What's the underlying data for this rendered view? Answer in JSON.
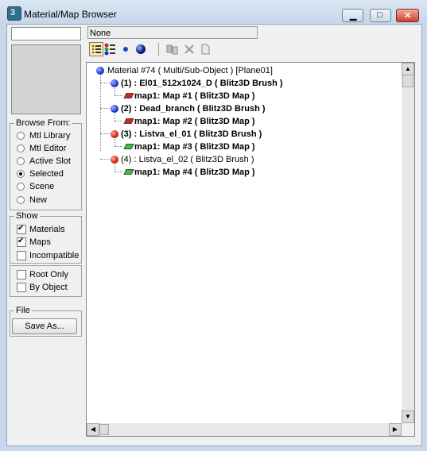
{
  "window": {
    "title": "Material/Map Browser",
    "minimize": "▁",
    "maximize": "□",
    "close": "✕"
  },
  "left": {
    "name_value": "",
    "browse_from": {
      "title": "Browse From:",
      "options": [
        {
          "label": "Mtl Library",
          "selected": false
        },
        {
          "label": "Mtl Editor",
          "selected": false
        },
        {
          "label": "Active Slot",
          "selected": false
        },
        {
          "label": "Selected",
          "selected": true
        },
        {
          "label": "Scene",
          "selected": false
        },
        {
          "label": "New",
          "selected": false
        }
      ]
    },
    "show": {
      "title": "Show",
      "options": [
        {
          "label": "Materials",
          "checked": true
        },
        {
          "label": "Maps",
          "checked": true
        },
        {
          "label": "Incompatible",
          "checked": false
        }
      ]
    },
    "filter": {
      "options": [
        {
          "label": "Root Only",
          "checked": false
        },
        {
          "label": "By Object",
          "checked": false
        }
      ]
    },
    "file": {
      "title": "File",
      "save_as": "Save As..."
    }
  },
  "right": {
    "path_value": "None",
    "toolbar_icons": [
      "list-view-icon",
      "list-icons-view-icon",
      "small-icons-view-icon",
      "large-icons-view-icon",
      "update-scene-materials-icon",
      "delete-icon",
      "clear-library-icon"
    ],
    "tree": [
      {
        "text": "Material #74  ( Multi/Sub-Object ) [Plane01]",
        "icon": "blue",
        "bold": false
      },
      {
        "text": "(1) : El01_512x1024_D  ( Blitz3D Brush )",
        "icon": "blue",
        "bold": true
      },
      {
        "text": "map1: Map #1  ( Blitz3D Map )",
        "icon": "red-map",
        "bold": true
      },
      {
        "text": "(2) : Dead_branch  ( Blitz3D Brush )",
        "icon": "blue",
        "bold": true
      },
      {
        "text": "map1: Map #2  ( Blitz3D Map )",
        "icon": "red-map",
        "bold": true
      },
      {
        "text": "(3) : Listva_el_01  ( Blitz3D Brush )",
        "icon": "red",
        "bold": true
      },
      {
        "text": "map1: Map #3  ( Blitz3D Map )",
        "icon": "green-map",
        "bold": true
      },
      {
        "text": "(4) : Listva_el_02  ( Blitz3D Brush )",
        "icon": "red",
        "bold": false
      },
      {
        "text": "map1: Map #4  ( Blitz3D Map )",
        "icon": "green-map",
        "bold": true
      }
    ]
  }
}
